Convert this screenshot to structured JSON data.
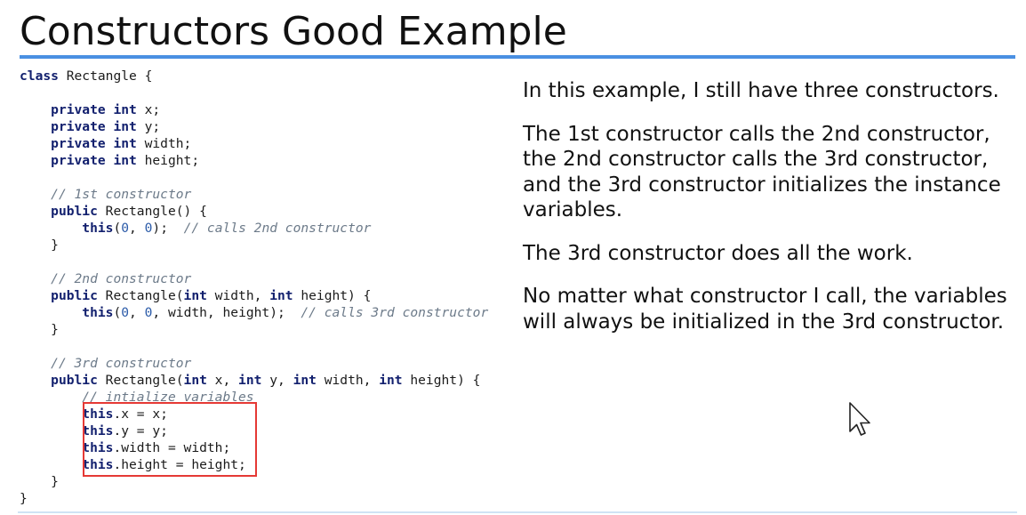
{
  "slide": {
    "title": "Constructors Good Example",
    "accent_color": "#4a90e2",
    "highlight_color": "#e53935"
  },
  "code": {
    "lines": [
      [
        {
          "t": "class",
          "k": "kw"
        },
        {
          "t": " Rectangle {"
        }
      ],
      [],
      [
        {
          "t": "    "
        },
        {
          "t": "private",
          "k": "kw"
        },
        {
          "t": " "
        },
        {
          "t": "int",
          "k": "kw"
        },
        {
          "t": " x;"
        }
      ],
      [
        {
          "t": "    "
        },
        {
          "t": "private",
          "k": "kw"
        },
        {
          "t": " "
        },
        {
          "t": "int",
          "k": "kw"
        },
        {
          "t": " y;"
        }
      ],
      [
        {
          "t": "    "
        },
        {
          "t": "private",
          "k": "kw"
        },
        {
          "t": " "
        },
        {
          "t": "int",
          "k": "kw"
        },
        {
          "t": " width;"
        }
      ],
      [
        {
          "t": "    "
        },
        {
          "t": "private",
          "k": "kw"
        },
        {
          "t": " "
        },
        {
          "t": "int",
          "k": "kw"
        },
        {
          "t": " height;"
        }
      ],
      [],
      [
        {
          "t": "    "
        },
        {
          "t": "// 1st constructor",
          "k": "cm"
        }
      ],
      [
        {
          "t": "    "
        },
        {
          "t": "public",
          "k": "kw"
        },
        {
          "t": " Rectangle() {"
        }
      ],
      [
        {
          "t": "        "
        },
        {
          "t": "this",
          "k": "kw"
        },
        {
          "t": "("
        },
        {
          "t": "0",
          "k": "num"
        },
        {
          "t": ", "
        },
        {
          "t": "0",
          "k": "num"
        },
        {
          "t": ");  "
        },
        {
          "t": "// calls 2nd constructor",
          "k": "cm"
        }
      ],
      [
        {
          "t": "    }"
        }
      ],
      [],
      [
        {
          "t": "    "
        },
        {
          "t": "// 2nd constructor",
          "k": "cm"
        }
      ],
      [
        {
          "t": "    "
        },
        {
          "t": "public",
          "k": "kw"
        },
        {
          "t": " Rectangle("
        },
        {
          "t": "int",
          "k": "kw"
        },
        {
          "t": " width, "
        },
        {
          "t": "int",
          "k": "kw"
        },
        {
          "t": " height) {"
        }
      ],
      [
        {
          "t": "        "
        },
        {
          "t": "this",
          "k": "kw"
        },
        {
          "t": "("
        },
        {
          "t": "0",
          "k": "num"
        },
        {
          "t": ", "
        },
        {
          "t": "0",
          "k": "num"
        },
        {
          "t": ", width, height);  "
        },
        {
          "t": "// calls 3rd constructor",
          "k": "cm"
        }
      ],
      [
        {
          "t": "    }"
        }
      ],
      [],
      [
        {
          "t": "    "
        },
        {
          "t": "// 3rd constructor",
          "k": "cm"
        }
      ],
      [
        {
          "t": "    "
        },
        {
          "t": "public",
          "k": "kw"
        },
        {
          "t": " Rectangle("
        },
        {
          "t": "int",
          "k": "kw"
        },
        {
          "t": " x, "
        },
        {
          "t": "int",
          "k": "kw"
        },
        {
          "t": " y, "
        },
        {
          "t": "int",
          "k": "kw"
        },
        {
          "t": " width, "
        },
        {
          "t": "int",
          "k": "kw"
        },
        {
          "t": " height) {"
        }
      ],
      [
        {
          "t": "        "
        },
        {
          "t": "// intialize variables",
          "k": "cm"
        }
      ],
      [
        {
          "t": "        "
        },
        {
          "t": "this",
          "k": "kw"
        },
        {
          "t": ".x = x;"
        }
      ],
      [
        {
          "t": "        "
        },
        {
          "t": "this",
          "k": "kw"
        },
        {
          "t": ".y = y;"
        }
      ],
      [
        {
          "t": "        "
        },
        {
          "t": "this",
          "k": "kw"
        },
        {
          "t": ".width = width;"
        }
      ],
      [
        {
          "t": "        "
        },
        {
          "t": "this",
          "k": "kw"
        },
        {
          "t": ".height = height;"
        }
      ],
      [
        {
          "t": "    }"
        }
      ],
      [
        {
          "t": "}"
        }
      ]
    ]
  },
  "explanation": {
    "paragraphs": [
      "In this example, I still have three constructors.",
      "The 1st constructor calls the 2nd constructor, the 2nd constructor calls the 3rd constructor, and the 3rd constructor initializes the instance variables.",
      "The 3rd constructor does all the work.",
      "No matter what constructor I call, the variables will always be initialized in the 3rd constructor."
    ]
  }
}
